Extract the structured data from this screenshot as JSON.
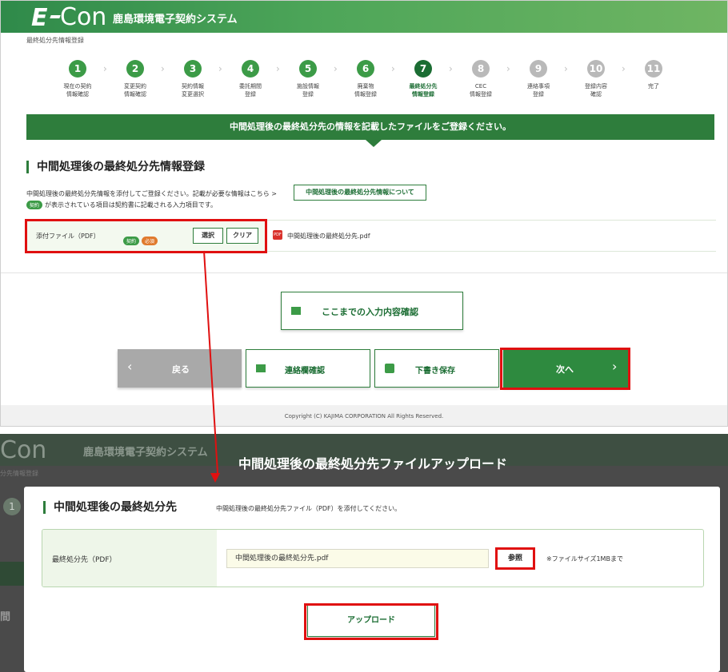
{
  "top": {
    "logo": {
      "e": "E",
      "con": "Con"
    },
    "system_name": "鹿島環境電子契約システム",
    "breadcrumb": "最終処分先情報登録",
    "steps": [
      {
        "num": "1",
        "label": "現在の契約\n情報確認",
        "state": "done"
      },
      {
        "num": "2",
        "label": "変更契約\n情報確認",
        "state": "done"
      },
      {
        "num": "3",
        "label": "契約情報\n変更選択",
        "state": "done"
      },
      {
        "num": "4",
        "label": "委託期間\n登録",
        "state": "done"
      },
      {
        "num": "5",
        "label": "施設情報\n登録",
        "state": "done"
      },
      {
        "num": "6",
        "label": "廃棄物\n情報登録",
        "state": "done"
      },
      {
        "num": "7",
        "label": "最終処分先\n情報登録",
        "state": "current"
      },
      {
        "num": "8",
        "label": "CEC\n情報登録",
        "state": "todo"
      },
      {
        "num": "9",
        "label": "連絡事項\n登録",
        "state": "todo"
      },
      {
        "num": "10",
        "label": "登録内容\n確認",
        "state": "todo"
      },
      {
        "num": "11",
        "label": "完了",
        "state": "todo"
      }
    ],
    "banner": "中間処理後の最終処分先の情報を記載したファイルをご登録ください。",
    "section_title": "中間処理後の最終処分先情報登録",
    "desc1": "中間処理後の最終処分先情報を添付してご登録ください。記載が必要な情報はこちら >",
    "info_button": "中間処理後の最終処分先情報について",
    "desc2_tag": "契約",
    "desc2": "が表示されている項目は契約書に記載される入力項目です。",
    "file_label": "添付ファイル（PDF）",
    "tag_contract": "契約",
    "tag_required": "必須",
    "select_button": "選択",
    "clear_button": "クリア",
    "pdf_icon": "PDF",
    "file_name": "中間処理後の最終処分先.pdf",
    "confirm_button": "ここまでの入力内容確認",
    "back_button": "戻る",
    "contact_button": "連絡欄確認",
    "draft_button": "下書き保存",
    "next_button": "次へ",
    "copyright": "Copyright (C) KAJIMA CORPORATION All Rights Reserved."
  },
  "bottom": {
    "bg_logo": "Con",
    "bg_system_name": "鹿島環境電子契約システム",
    "bg_breadcrumb": "分先情報登録",
    "bg_step": "1",
    "bg_left_text": "間",
    "modal_title": "中間処理後の最終処分先ファイルアップロード",
    "section_title": "中間処理後の最終処分先",
    "subtitle": "中間処理後の最終処分先ファイル（PDF）を添付してください。",
    "field_label": "最終処分先（PDF）",
    "field_value": "中間処理後の最終処分先.pdf",
    "browse_button": "参照",
    "note": "※ファイルサイズ1MBまで",
    "upload_button": "アップロード"
  },
  "colors": {
    "brand_green": "#2e7d3c",
    "highlight_red": "#e01010"
  },
  "icons": {
    "pdf": "pdf-icon",
    "doc": "document-icon",
    "save": "save-icon",
    "arrow": "down-arrow"
  }
}
